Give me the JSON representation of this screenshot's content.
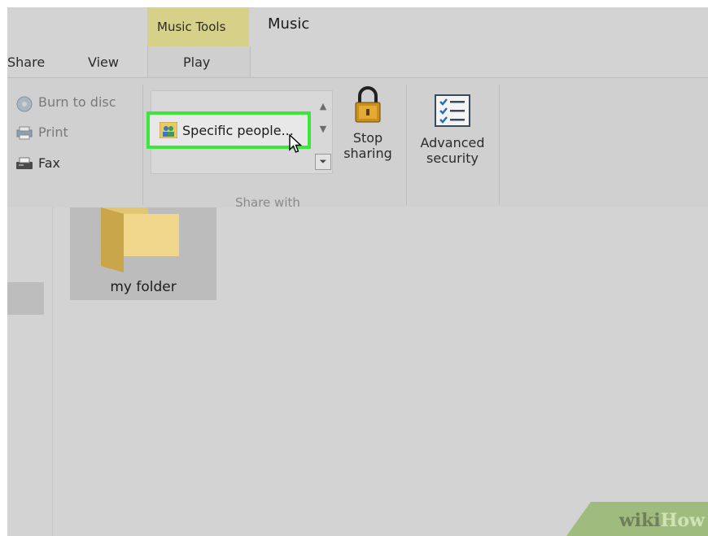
{
  "title": {
    "context_tools": "Music Tools",
    "window": "Music"
  },
  "tabs": [
    {
      "label": "Share"
    },
    {
      "label": "View"
    },
    {
      "label": "Play"
    }
  ],
  "ribbon": {
    "send_group": [
      {
        "label": "Burn to disc",
        "icon": "burn-disc-icon"
      },
      {
        "label": "Print",
        "icon": "printer-icon"
      },
      {
        "label": "Fax",
        "icon": "fax-icon"
      }
    ],
    "share_with": {
      "selected_item": "Specific people...",
      "group_label": "Share with",
      "highlight_color": "#3de63d"
    },
    "stop_sharing": {
      "line1": "Stop",
      "line2": "sharing",
      "icon": "lock-icon"
    },
    "advanced_security": {
      "line1": "Advanced",
      "line2": "security",
      "icon": "checklist-icon"
    }
  },
  "content": {
    "folder": {
      "name": "my folder",
      "icon": "folder-icon"
    }
  },
  "watermark": {
    "part1": "wiki",
    "part2": "How"
  }
}
